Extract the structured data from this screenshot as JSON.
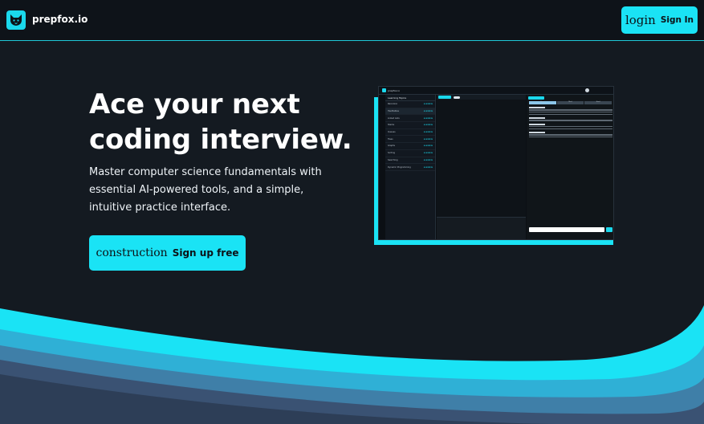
{
  "header": {
    "brand": "prepfox.io",
    "login": {
      "icon_text": "login",
      "label": "Sign In"
    }
  },
  "hero": {
    "headline": "Ace your next coding interview.",
    "subtext": "Master computer science fundamentals with essential AI-powered tools, and a simple, intuitive practice interface.",
    "signup": {
      "icon_text": "construction",
      "label": "Sign up free"
    }
  },
  "preview": {
    "sidebar_title": "Learning Topics",
    "topics": [
      {
        "name": "Recursion",
        "status": "available"
      },
      {
        "name": "Hashtables",
        "status": "available"
      },
      {
        "name": "Linked Lists",
        "status": "available"
      },
      {
        "name": "Stacks",
        "status": "available"
      },
      {
        "name": "Queues",
        "status": "available"
      },
      {
        "name": "Trees",
        "status": "available"
      },
      {
        "name": "Graphs",
        "status": "available"
      },
      {
        "name": "Sorting",
        "status": "available"
      },
      {
        "name": "Searching",
        "status": "available"
      },
      {
        "name": "Dynamic Programming",
        "status": "available"
      }
    ],
    "difficulty": [
      "Easy",
      "Med",
      "Hard"
    ]
  },
  "colors": {
    "accent": "#1ae3f5",
    "background": "#141a21",
    "header_bg": "#0e1319",
    "wave_1": "#1ae3f5",
    "wave_2": "#2fb0d6",
    "wave_3": "#3f7fa8",
    "wave_4": "#3a5273"
  }
}
